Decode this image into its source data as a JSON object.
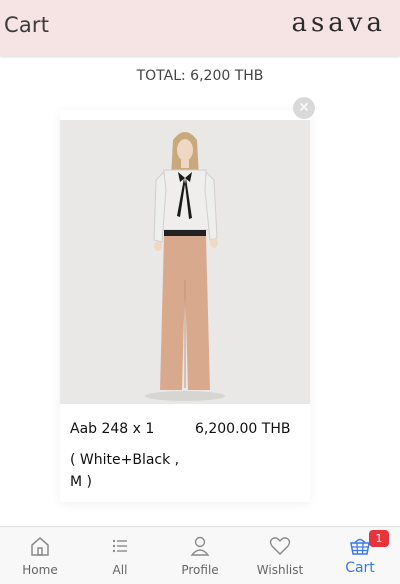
{
  "header": {
    "title": "Cart",
    "logo": "asava"
  },
  "cart": {
    "total_text": "TOTAL: 6,200 THB",
    "items": [
      {
        "name": "Aab 248 x 1",
        "price": "6,200.00 THB",
        "variant": "( White+Black , M )"
      }
    ]
  },
  "tabbar": {
    "tabs": [
      {
        "label": "Home",
        "icon": "home-icon"
      },
      {
        "label": "All",
        "icon": "list-icon"
      },
      {
        "label": "Profile",
        "icon": "profile-icon"
      },
      {
        "label": "Wishlist",
        "icon": "heart-icon"
      },
      {
        "label": "Cart",
        "icon": "basket-icon",
        "active": true
      }
    ],
    "cart_badge": "1"
  },
  "colors": {
    "header_bg": "#f6e4e4",
    "active_tab": "#3b78e7",
    "badge": "#e8333b"
  }
}
